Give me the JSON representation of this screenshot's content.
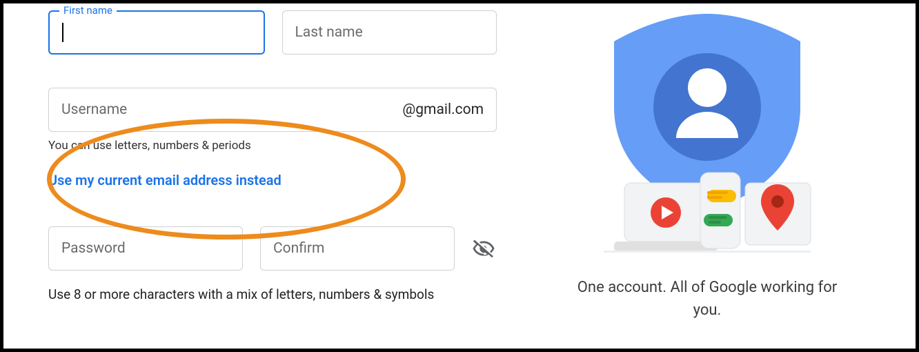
{
  "form": {
    "first_name": {
      "label": "First name",
      "value": ""
    },
    "last_name": {
      "placeholder": "Last name"
    },
    "username": {
      "placeholder": "Username",
      "suffix": "@gmail.com"
    },
    "username_helper": "You can use letters, numbers & periods",
    "use_current_email": "Use my current email address instead",
    "password": {
      "placeholder": "Password"
    },
    "confirm": {
      "placeholder": "Confirm"
    },
    "password_helper": "Use 8 or more characters with a mix of letters, numbers & symbols"
  },
  "right": {
    "tagline": "One account. All of Google working for you."
  }
}
